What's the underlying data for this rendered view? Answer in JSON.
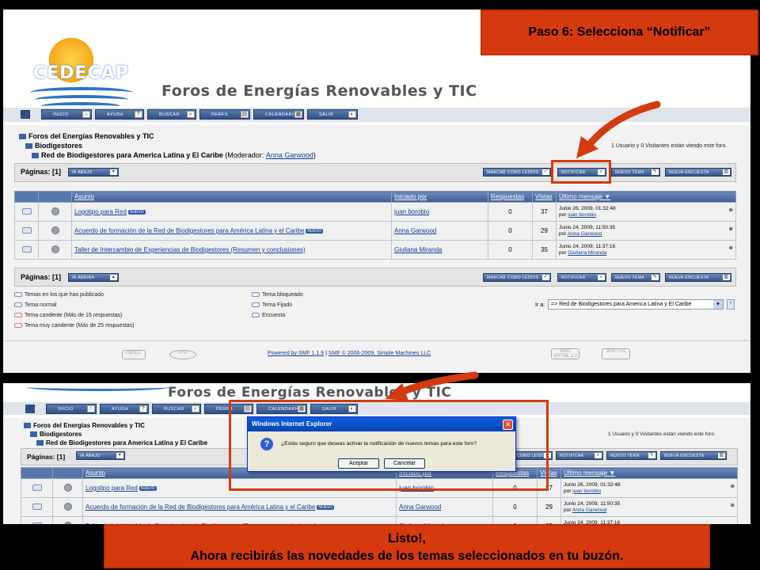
{
  "callout_top": "Paso 6: Selecciona “Notificar”",
  "callout_bottom_line1": "Listo!,",
  "callout_bottom_line2": "Ahora recibirás las novedades de los temas seleccionados en tu buzón.",
  "logo_text": "CEDECAP",
  "site_title": "Foros de Energías Renovables y TIC",
  "nav": [
    "INICIO",
    "AYUDA",
    "BUSCAR",
    "PERFIL",
    "CALENDARIO",
    "SALIR"
  ],
  "breadcrumb": {
    "root": "Foros del Energías Renovables y TIC",
    "cat": "Biodigestores",
    "board": "Red de Biodigestores para America Latina y El Caribe",
    "moderator_label": "(Moderador:",
    "moderator": "Anna Garwood",
    "moderator_close": ")"
  },
  "visitors": "1 Usuario y 0 Visitantes están viendo este foro.",
  "pages_label": "Páginas: [1]",
  "goto_down": "IR ABAJO",
  "goto_up": "IR ARRIBA",
  "actions": [
    "MARCAR COMO LEÍDOS",
    "NOTIFICAR",
    "NUEVO TEMA",
    "NUEVA ENCUESTA"
  ],
  "table": {
    "headers": [
      "Asunto",
      "Iniciado por",
      "Respuestas",
      "Vistas",
      "Último mensaje"
    ],
    "new_badge": "NUEVO",
    "rows": [
      {
        "subject": "Logotipo para Red",
        "starter": "juan borobio",
        "replies": "0",
        "views": "37",
        "date": "Junio 26, 2009, 01:32:48",
        "by": "por",
        "byuser": "juan borobio"
      },
      {
        "subject": "Acuerdo de formación de la Red de Biodigestores para América Latina y el Caribe",
        "starter": "Anna Garwood",
        "replies": "0",
        "views": "29",
        "date": "Junio 24, 2009, 11:50:35",
        "by": "por",
        "byuser": "Anna Garwood"
      },
      {
        "subject": "Taller de Intercambio de Experiencias de Biodigestores (Resumen y conclusiones)",
        "starter": "Giuliana Miranda",
        "replies": "0",
        "views": "35",
        "date": "Junio 24, 2009, 11:37:16",
        "by": "por",
        "byuser": "Giuliana Miranda"
      }
    ]
  },
  "legend_left": [
    "Temas en los que has publicado",
    "Tema normal",
    "Tema candente (Más de 15 respuestas)",
    "Tema muy candente (Más de 25 respuestas)"
  ],
  "legend_mid": [
    "Tema bloqueado",
    "Tema Fijado",
    "Encuesta"
  ],
  "goto_label": "Ir a:",
  "goto_value": "=> Red de Biodigestores para America Latina y El Caribe",
  "footer": {
    "powered": "Powered by SMF 1.1.9",
    "sep": " | ",
    "copyright": "SMF © 2006-2009, Simple Machines LLC"
  },
  "badges": [
    "MySQL",
    "PHP",
    "W3C XHTML 1.0",
    "W3C css"
  ],
  "dialog": {
    "title": "Windows Internet Explorer",
    "message": "¿Estás seguro que deseas activar la notificación de nuevos temas para este foro?",
    "accept": "Aceptar",
    "cancel": "Cancelar"
  },
  "colors": {
    "accent": "#d53a0e",
    "nav": "#3c5c93"
  }
}
